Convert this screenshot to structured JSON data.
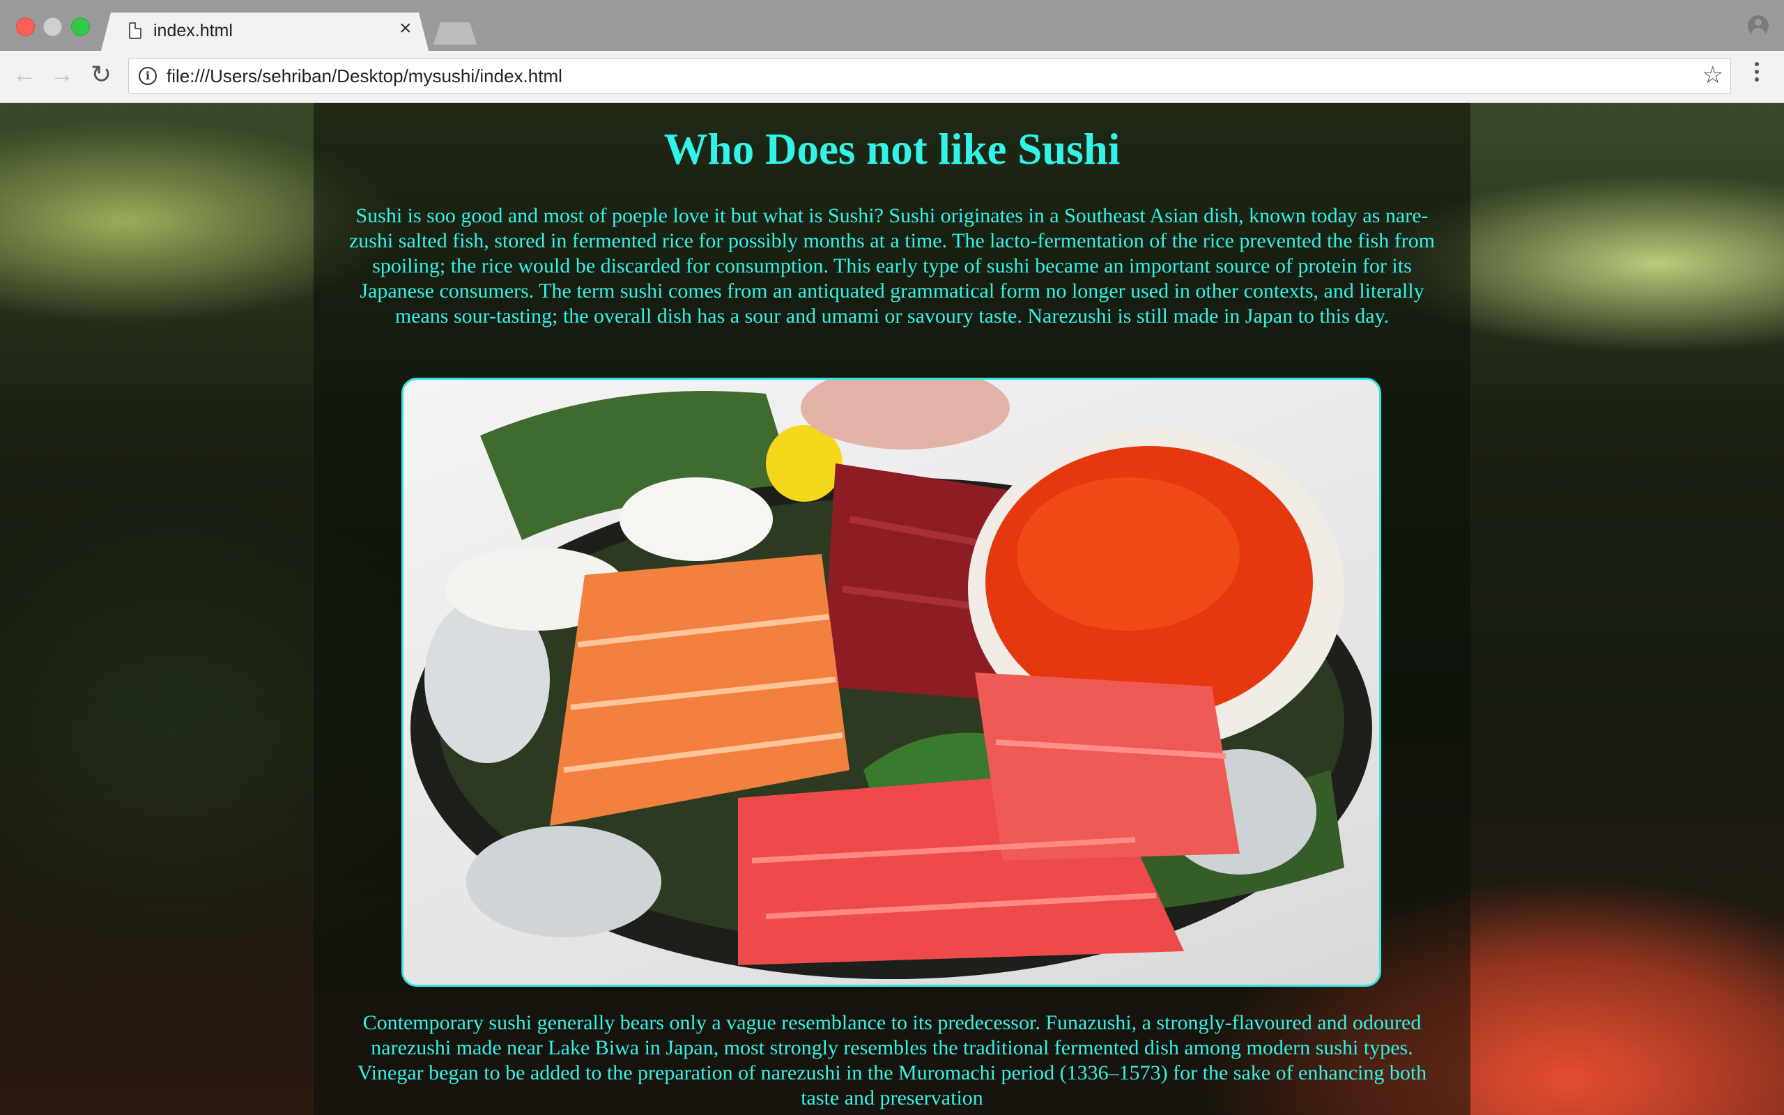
{
  "browser": {
    "tab_title": "index.html",
    "tab_close": "×",
    "url": "file:///Users/sehriban/Desktop/mysushi/index.html",
    "back_glyph": "←",
    "forward_glyph": "→",
    "reload_glyph": "↻",
    "info_glyph": "i",
    "bookmark_glyph": "☆"
  },
  "page": {
    "heading": "Who Does not like Sushi",
    "paragraph_1": "Sushi is soo good and most of poeple love it but what is Sushi? Sushi originates in a Southeast Asian dish, known today as nare-zushi salted fish, stored in fermented rice for possibly months at a time. The lacto-fermentation of the rice prevented the fish from spoiling; the rice would be discarded for consumption. This early type of sushi became an important source of protein for its Japanese consumers. The term sushi comes from an antiquated grammatical form no longer used in other contexts, and literally means sour-tasting; the overall dish has a sour and umami or savoury taste. Narezushi is still made in Japan to this day.",
    "paragraph_2": "Contemporary sushi generally bears only a vague resemblance to its predecessor. Funazushi, a strongly-flavoured and odoured narezushi made near Lake Biwa in Japan, most strongly resembles the traditional fermented dish among modern sushi types. Vinegar began to be added to the preparation of narezushi in the Muromachi period (1336–1573) for the sake of enhancing both taste and preservation"
  },
  "colors": {
    "text_accent": "#33f2e8",
    "frame_border": "#35e6e0"
  }
}
